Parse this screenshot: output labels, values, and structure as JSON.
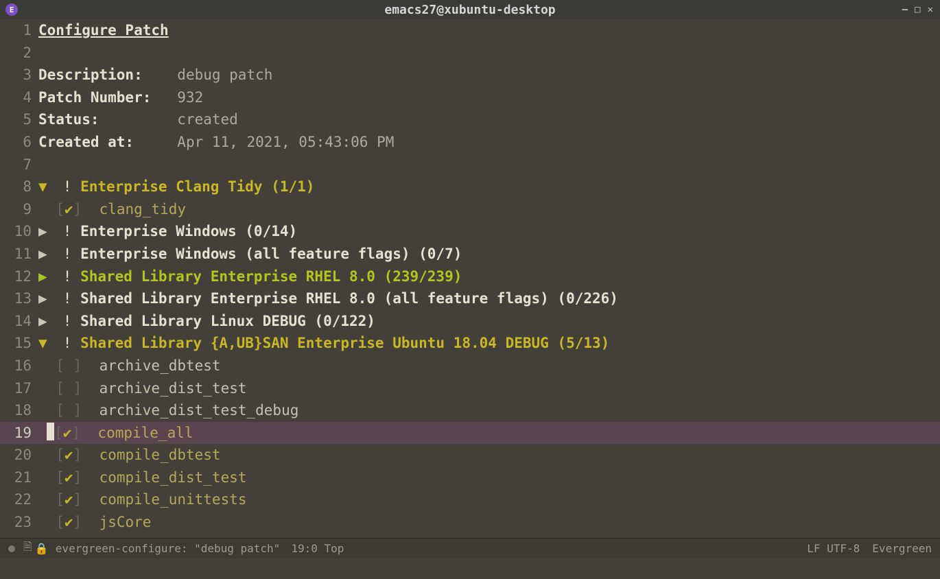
{
  "window": {
    "title": "emacs27@xubuntu-desktop"
  },
  "buffer": {
    "heading": "Configure Patch",
    "fields": {
      "description_label": "Description:",
      "description_value": "debug patch",
      "patch_number_label": "Patch Number:",
      "patch_number_value": "932",
      "status_label": "Status:",
      "status_value": "created",
      "created_at_label": "Created at:",
      "created_at_value": "Apr 11, 2021, 05:43:06 PM"
    },
    "sections": [
      {
        "expanded": true,
        "complete": false,
        "label": "Enterprise Clang Tidy (1/1)",
        "tasks": [
          {
            "checked": true,
            "name": "clang_tidy"
          }
        ]
      },
      {
        "expanded": false,
        "complete": false,
        "label": "Enterprise Windows (0/14)",
        "tasks": []
      },
      {
        "expanded": false,
        "complete": false,
        "label": "Enterprise Windows (all feature flags) (0/7)",
        "tasks": []
      },
      {
        "expanded": false,
        "complete": true,
        "label": "Shared Library Enterprise RHEL 8.0 (239/239)",
        "tasks": []
      },
      {
        "expanded": false,
        "complete": false,
        "label": "Shared Library Enterprise RHEL 8.0 (all feature flags) (0/226)",
        "tasks": []
      },
      {
        "expanded": false,
        "complete": false,
        "label": "Shared Library Linux DEBUG (0/122)",
        "tasks": []
      },
      {
        "expanded": true,
        "complete": false,
        "label": "Shared Library {A,UB}SAN Enterprise Ubuntu 18.04 DEBUG (5/13)",
        "tasks": [
          {
            "checked": false,
            "name": "archive_dbtest"
          },
          {
            "checked": false,
            "name": "archive_dist_test"
          },
          {
            "checked": false,
            "name": "archive_dist_test_debug"
          },
          {
            "checked": true,
            "name": "compile_all",
            "cursor": true
          },
          {
            "checked": true,
            "name": "compile_dbtest"
          },
          {
            "checked": true,
            "name": "compile_dist_test"
          },
          {
            "checked": true,
            "name": "compile_unittests"
          },
          {
            "checked": true,
            "name": "jsCore"
          }
        ]
      }
    ]
  },
  "modeline": {
    "buffer_name": "evergreen-configure: \"debug patch\"",
    "position": "19:0 Top",
    "encoding": "LF UTF-8",
    "mode": "Evergreen"
  },
  "glyphs": {
    "arrow_down": "▼",
    "arrow_right": "▶",
    "bang": "!",
    "check": "✔",
    "lbracket": "[",
    "rbracket": "]",
    "file_icon": "🗎",
    "lock_icon": "🔒"
  }
}
